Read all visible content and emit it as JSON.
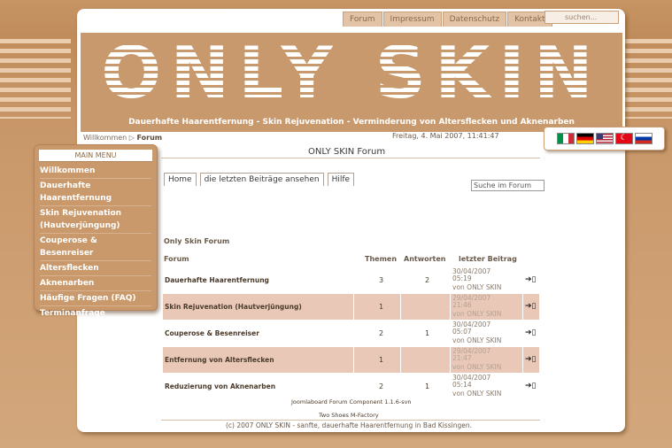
{
  "topnav": [
    "Forum",
    "Impressum",
    "Datenschutz",
    "Kontakt"
  ],
  "search_top": "suchen...",
  "logo": "ONLY SKIN",
  "tagline": "Dauerhafte Haarentfernung - Skin Rejuvenation - Verminderung von Altersflecken und Aknenarben",
  "breadcrumb": {
    "home": "Willkommen",
    "current": "Forum"
  },
  "date": "Freitag, 4. Mai 2007, 11:41:47",
  "flags": [
    {
      "name": "italy-flag",
      "colors": [
        "#009246",
        "#ffffff",
        "#ce2b37"
      ]
    },
    {
      "name": "germany-flag",
      "colors": [
        "#000000",
        "#dd0000",
        "#ffce00"
      ]
    },
    {
      "name": "usa-flag",
      "colors": [
        "#b22234",
        "#ffffff",
        "#3c3b6e"
      ]
    },
    {
      "name": "turkey-flag",
      "colors": [
        "#e30a17"
      ]
    },
    {
      "name": "russia-flag",
      "colors": [
        "#ffffff",
        "#0039a6",
        "#d52b1e"
      ]
    }
  ],
  "menu": {
    "title": "MAIN MENU",
    "items": [
      "Willkommen",
      "Dauerhafte Haarentfernung",
      "Skin Rejuvenation (Hautverjüngung)",
      "Couperose & Besenreiser",
      "Altersflecken",
      "Aknenarben",
      "Häufige Fragen (FAQ)",
      "Terminanfrage"
    ]
  },
  "forum": {
    "title": "ONLY SKIN Forum",
    "tabs": [
      "Home",
      "die letzten Beiträge ansehen",
      "Hilfe"
    ],
    "search": "Suche im Forum",
    "section": "Only Skin Forum",
    "columns": {
      "forum": "Forum",
      "themen": "Themen",
      "antworten": "Antworten",
      "letzter": "letzter Beitrag"
    },
    "rows": [
      {
        "name": "Dauerhafte Haarentfernung",
        "themen": "3",
        "antworten": "2",
        "date": "30/04/2007",
        "time": "05:19",
        "by": "von ONLY SKIN"
      },
      {
        "name": "Skin Rejuvenation (Hautverjüngung)",
        "themen": "1",
        "antworten": "",
        "date": "29/04/2007",
        "time": "21:46",
        "by": "von ONLY SKIN"
      },
      {
        "name": "Couperose & Besenreiser",
        "themen": "2",
        "antworten": "1",
        "date": "30/04/2007",
        "time": "05:07",
        "by": "von ONLY SKIN"
      },
      {
        "name": "Entfernung von Altersflecken",
        "themen": "1",
        "antworten": "",
        "date": "29/04/2007",
        "time": "21:47",
        "by": "von ONLY SKIN"
      },
      {
        "name": "Reduzierung von Aknenarben",
        "themen": "2",
        "antworten": "1",
        "date": "30/04/2007",
        "time": "05:14",
        "by": "von ONLY SKIN"
      }
    ],
    "footer1": "Joomlaboard Forum Component 1.1.6-svn",
    "footer2": "Two Shoes M-Factory"
  },
  "copyright": "(c) 2007 ONLY SKIN - sanfte, dauerhafte Haarentfernung in Bad Kissingen."
}
